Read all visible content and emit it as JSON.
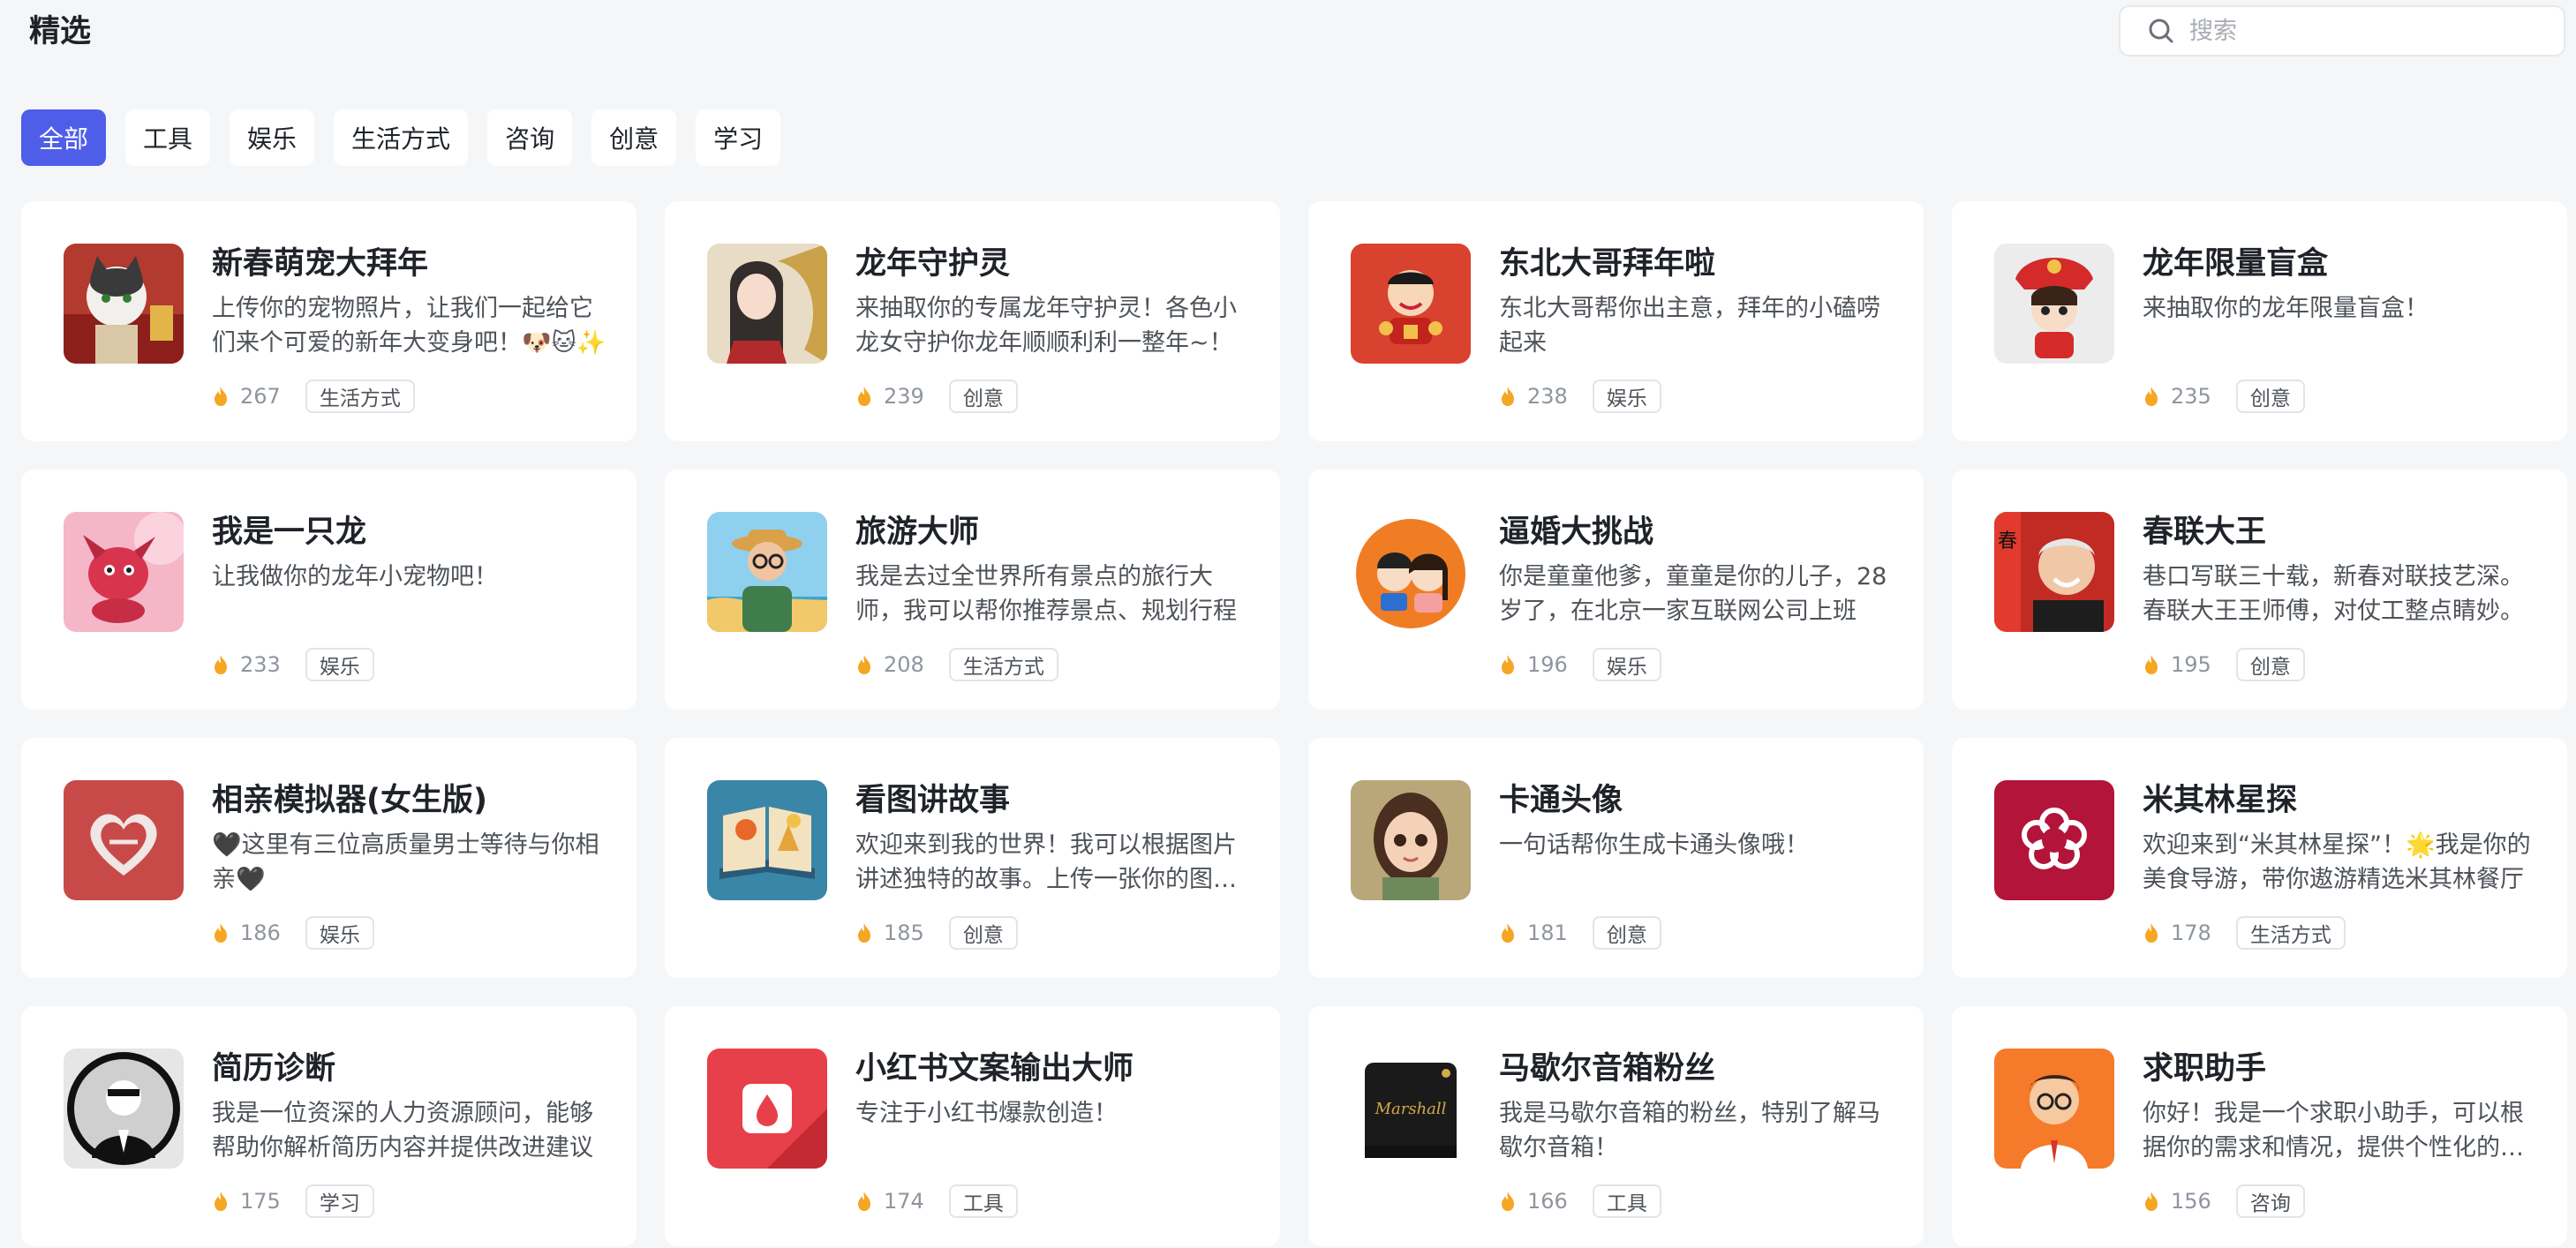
{
  "page_title": "精选",
  "search": {
    "placeholder": "搜索",
    "value": ""
  },
  "tabs": [
    {
      "label": "全部",
      "active": true
    },
    {
      "label": "工具",
      "active": false
    },
    {
      "label": "娱乐",
      "active": false
    },
    {
      "label": "生活方式",
      "active": false
    },
    {
      "label": "咨询",
      "active": false
    },
    {
      "label": "创意",
      "active": false
    },
    {
      "label": "学习",
      "active": false
    }
  ],
  "colors": {
    "accent": "#4e5ee8",
    "flame": "#f5a623",
    "card_bg": "#ffffff",
    "page_bg": "#f5f6f8"
  },
  "cards": [
    {
      "title": "新春萌宠大拜年",
      "desc": "上传你的宠物照片，让我们一起给它们来个可爱的新年大变身吧！🐶🐱✨",
      "count": "267",
      "tag": "生活方式",
      "icon": "pet-cat-avatar-icon"
    },
    {
      "title": "龙年守护灵",
      "desc": "来抽取你的专属龙年守护灵！各色小龙女守护你龙年顺顺利利一整年~！",
      "count": "239",
      "tag": "创意",
      "icon": "dragon-girl-avatar-icon"
    },
    {
      "title": "东北大哥拜年啦",
      "desc": "东北大哥帮你出主意，拜年的小磕唠起来",
      "count": "238",
      "tag": "娱乐",
      "icon": "northeast-brother-avatar-icon"
    },
    {
      "title": "龙年限量盲盒",
      "desc": "来抽取你的龙年限量盲盒！",
      "count": "235",
      "tag": "创意",
      "icon": "blind-box-avatar-icon"
    },
    {
      "title": "我是一只龙",
      "desc": "让我做你的龙年小宠物吧！",
      "count": "233",
      "tag": "娱乐",
      "icon": "baby-dragon-avatar-icon"
    },
    {
      "title": "旅游大师",
      "desc": "我是去过全世界所有景点的旅行大师，我可以帮你推荐景点、规划行程",
      "count": "208",
      "tag": "生活方式",
      "icon": "traveler-avatar-icon"
    },
    {
      "title": "逼婚大挑战",
      "desc": "你是童童他爹，童童是你的儿子，28岁了，在北京一家互联网公司上班",
      "count": "196",
      "tag": "娱乐",
      "icon": "couple-avatar-icon"
    },
    {
      "title": "春联大王",
      "desc": "巷口写联三十载，新春对联技艺深。春联大王王师傅，对仗工整点睛妙。",
      "count": "195",
      "tag": "创意",
      "icon": "old-master-avatar-icon"
    },
    {
      "title": "相亲模拟器(女生版)",
      "desc": "🖤这里有三位高质量男士等待与你相亲🖤",
      "count": "186",
      "tag": "娱乐",
      "icon": "heart-avatar-icon"
    },
    {
      "title": "看图讲故事",
      "desc": "欢迎来到我的世界！我可以根据图片讲述独特的故事。上传一张你的图片吧",
      "count": "185",
      "tag": "创意",
      "icon": "storybook-avatar-icon"
    },
    {
      "title": "卡通头像",
      "desc": "一句话帮你生成卡通头像哦！",
      "count": "181",
      "tag": "创意",
      "icon": "cartoon-girl-avatar-icon"
    },
    {
      "title": "米其林星探",
      "desc": "欢迎来到“米其林星探”！🌟我是你的美食导游，带你遨游精选米其林餐厅",
      "count": "178",
      "tag": "生活方式",
      "icon": "michelin-flower-avatar-icon"
    },
    {
      "title": "简历诊断",
      "desc": "我是一位资深的人力资源顾问，能够帮助你解析简历内容并提供改进建议",
      "count": "175",
      "tag": "学习",
      "icon": "hr-consultant-avatar-icon"
    },
    {
      "title": "小红书文案输出大师",
      "desc": "专注于小红书爆款创造！",
      "count": "174",
      "tag": "工具",
      "icon": "red-book-avatar-icon"
    },
    {
      "title": "马歇尔音箱粉丝",
      "desc": "我是马歇尔音箱的粉丝，特别了解马歇尔音箱！",
      "count": "166",
      "tag": "工具",
      "icon": "speaker-avatar-icon"
    },
    {
      "title": "求职助手",
      "desc": "你好！我是一个求职小助手，可以根据你的需求和情况，提供个性化的建议",
      "count": "156",
      "tag": "咨询",
      "icon": "job-helper-avatar-icon"
    }
  ]
}
